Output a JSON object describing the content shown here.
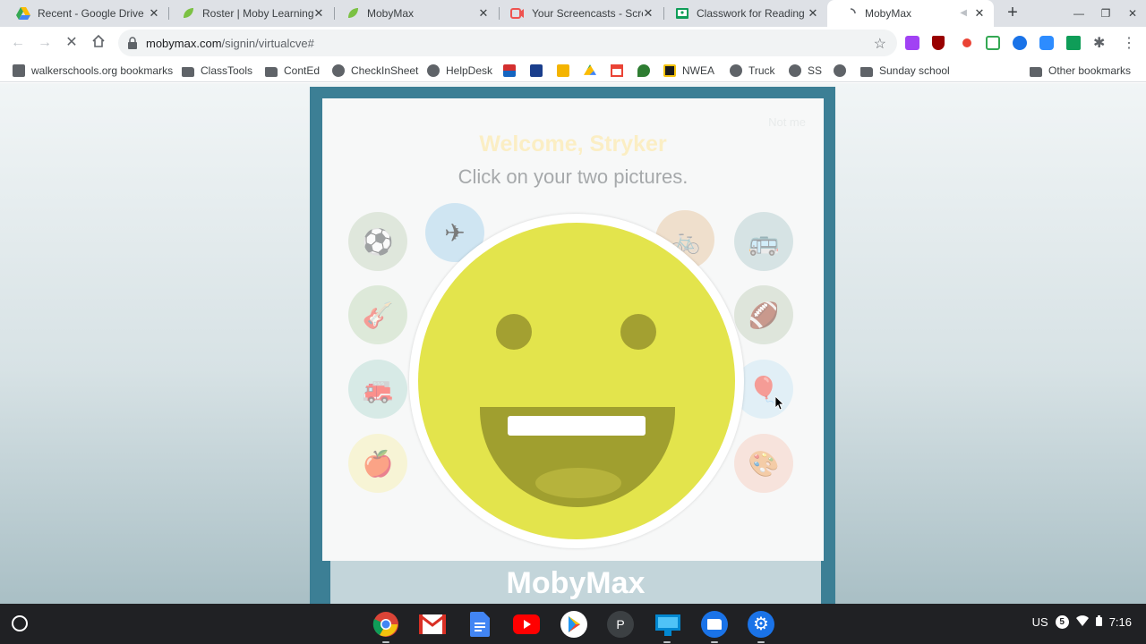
{
  "tabs": [
    {
      "title": "Recent - Google Drive",
      "favicon": "google-drive-icon"
    },
    {
      "title": "Roster | Moby Learning Ma",
      "favicon": "mobymax-icon"
    },
    {
      "title": "MobyMax",
      "favicon": "mobymax-icon"
    },
    {
      "title": "Your Screencasts - Screenc",
      "favicon": "screencastify-icon"
    },
    {
      "title": "Classwork for Reading and",
      "favicon": "google-classroom-icon"
    },
    {
      "title": "MobyMax",
      "favicon": "loading-icon",
      "active": true
    }
  ],
  "toolbar": {
    "url_host": "mobymax.com",
    "url_path": "/signin/virtualcve#"
  },
  "bookmarks": [
    {
      "label": "walkerschools.org bookmarks",
      "icon": "bookmarks-app-icon"
    },
    {
      "label": "ClassTools",
      "icon": "folder-icon"
    },
    {
      "label": "ContEd",
      "icon": "folder-icon"
    },
    {
      "label": "CheckInSheet",
      "icon": "globe-icon"
    },
    {
      "label": "HelpDesk",
      "icon": "globe-icon"
    },
    {
      "label": "",
      "icon": "flag-icon"
    },
    {
      "label": "",
      "icon": "pearson-icon"
    },
    {
      "label": "",
      "icon": "classroom-icon"
    },
    {
      "label": "",
      "icon": "drive-icon"
    },
    {
      "label": "",
      "icon": "gmail-icon"
    },
    {
      "label": "",
      "icon": "leaf-icon"
    },
    {
      "label": "NWEA",
      "icon": "nwea-icon"
    },
    {
      "label": "Truck",
      "icon": "globe-icon"
    },
    {
      "label": "SS",
      "icon": "globe-icon"
    },
    {
      "label": "",
      "icon": "globe-icon"
    },
    {
      "label": "Sunday school",
      "icon": "folder-icon"
    },
    {
      "label": "Other bookmarks",
      "icon": "folder-icon"
    }
  ],
  "page": {
    "not_me": "Not me",
    "welcome": "Welcome, Stryker",
    "instruction": "Click on your two pictures.",
    "brand": "MobyMax",
    "pictures": [
      {
        "name": "soccer-ball-icon",
        "glyph": "⚽"
      },
      {
        "name": "airplane-icon",
        "glyph": "✈"
      },
      {
        "name": "bicycle-icon",
        "glyph": "🚲"
      },
      {
        "name": "school-bus-icon",
        "glyph": "🚌"
      },
      {
        "name": "guitar-icon",
        "glyph": "🎸"
      },
      {
        "name": "football-icon",
        "glyph": "🏈"
      },
      {
        "name": "fire-truck-icon",
        "glyph": "🚒"
      },
      {
        "name": "hot-air-balloon-icon",
        "glyph": "🎈"
      },
      {
        "name": "apple-icon",
        "glyph": "🍎"
      },
      {
        "name": "paint-palette-icon",
        "glyph": "🎨"
      }
    ]
  },
  "shelf": {
    "apps": [
      "chrome-icon",
      "gmail-icon",
      "docs-icon",
      "youtube-icon",
      "play-store-icon",
      "p-app-icon",
      "classroom-icon",
      "files-icon",
      "settings-icon"
    ],
    "ime": "US",
    "notifications": "5",
    "time": "7:16"
  },
  "colors": {
    "frame": "#3c7f95",
    "welcome": "#fbeec4",
    "smiley": "#e3e44c"
  }
}
